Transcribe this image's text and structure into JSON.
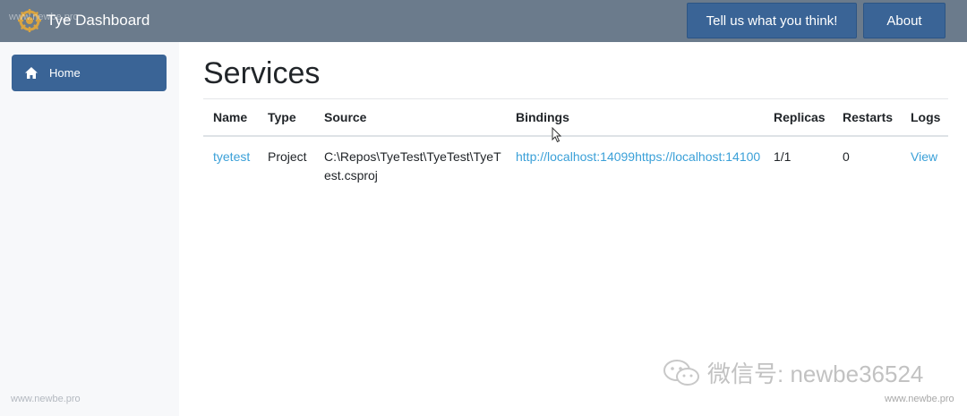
{
  "header": {
    "title": "Tye Dashboard",
    "logo_icon": "gear-wheel-icon",
    "feedback_button": "Tell us what you think!",
    "about_button": "About"
  },
  "sidebar": {
    "items": [
      {
        "label": "Home",
        "icon": "home-icon",
        "active": true
      }
    ]
  },
  "main": {
    "title": "Services",
    "table": {
      "columns": [
        "Name",
        "Type",
        "Source",
        "Bindings",
        "Replicas",
        "Restarts",
        "Logs"
      ],
      "rows": [
        {
          "name": "tyetest",
          "type": "Project",
          "source": "C:\\Repos\\TyeTest\\TyeTest\\TyeTest.csproj",
          "bindings": [
            "http://localhost:14099",
            "https://localhost:14100"
          ],
          "replicas": "1/1",
          "restarts": "0",
          "logs": "View"
        }
      ]
    }
  },
  "watermarks": {
    "top_left": "www.newbe.pro",
    "bottom_left": "www.newbe.pro",
    "bottom_right": "www.newbe.pro",
    "wechat": "微信号: newbe36524"
  },
  "colors": {
    "topbar": "#6b7b8c",
    "primary": "#3a6496",
    "link": "#3aa0d8",
    "sidebar": "#f7f8fa"
  }
}
